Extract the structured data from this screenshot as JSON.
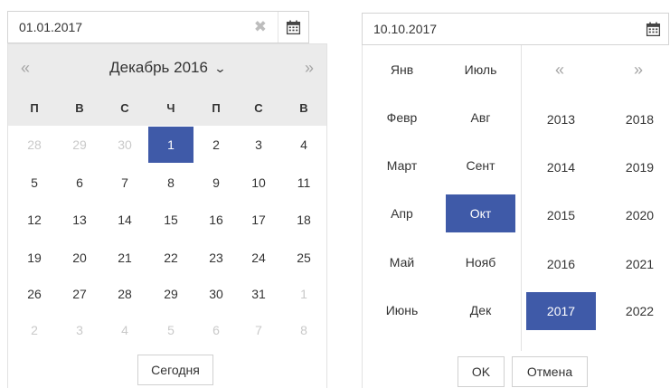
{
  "left_picker": {
    "input_value": "01.01.2017",
    "clear_glyph": "✖",
    "prev_glyph": "«",
    "next_glyph": "»",
    "month_label": "Декабрь 2016",
    "month_dropdown_glyph": "⌄",
    "weekdays": [
      "П",
      "В",
      "С",
      "Ч",
      "П",
      "С",
      "В"
    ],
    "weeks": [
      [
        {
          "d": "28",
          "muted": true
        },
        {
          "d": "29",
          "muted": true
        },
        {
          "d": "30",
          "muted": true
        },
        {
          "d": "1",
          "selected": true
        },
        {
          "d": "2"
        },
        {
          "d": "3"
        },
        {
          "d": "4"
        }
      ],
      [
        {
          "d": "5"
        },
        {
          "d": "6"
        },
        {
          "d": "7"
        },
        {
          "d": "8"
        },
        {
          "d": "9"
        },
        {
          "d": "10"
        },
        {
          "d": "11"
        }
      ],
      [
        {
          "d": "12"
        },
        {
          "d": "13"
        },
        {
          "d": "14"
        },
        {
          "d": "15"
        },
        {
          "d": "16"
        },
        {
          "d": "17"
        },
        {
          "d": "18"
        }
      ],
      [
        {
          "d": "19"
        },
        {
          "d": "20"
        },
        {
          "d": "21"
        },
        {
          "d": "22"
        },
        {
          "d": "23"
        },
        {
          "d": "24"
        },
        {
          "d": "25"
        }
      ],
      [
        {
          "d": "26"
        },
        {
          "d": "27"
        },
        {
          "d": "28"
        },
        {
          "d": "29"
        },
        {
          "d": "30"
        },
        {
          "d": "31"
        },
        {
          "d": "1",
          "muted": true
        }
      ],
      [
        {
          "d": "2",
          "muted": true
        },
        {
          "d": "3",
          "muted": true
        },
        {
          "d": "4",
          "muted": true
        },
        {
          "d": "5",
          "muted": true
        },
        {
          "d": "6",
          "muted": true
        },
        {
          "d": "7",
          "muted": true
        },
        {
          "d": "8",
          "muted": true
        }
      ]
    ],
    "today_label": "Сегодня",
    "calendar_icon": "calendar-icon"
  },
  "right_picker": {
    "input_value": "10.10.2017",
    "calendar_icon": "calendar-icon",
    "months_col1": [
      "Янв",
      "Февр",
      "Март",
      "Апр",
      "Май",
      "Июнь"
    ],
    "months_col2": [
      "Июль",
      "Авг",
      "Сент",
      "Окт",
      "Нояб",
      "Дек"
    ],
    "selected_month": "Окт",
    "prev_glyph": "«",
    "next_glyph": "»",
    "years_col1": [
      "2013",
      "2014",
      "2015",
      "2016",
      "2017"
    ],
    "years_col2": [
      "2018",
      "2019",
      "2020",
      "2021",
      "2022"
    ],
    "selected_year": "2017",
    "ok_label": "OK",
    "cancel_label": "Отмена"
  },
  "colors": {
    "accent": "#3f5aa8",
    "header_bg": "#ebebeb",
    "muted_text": "#c9c9c9"
  }
}
